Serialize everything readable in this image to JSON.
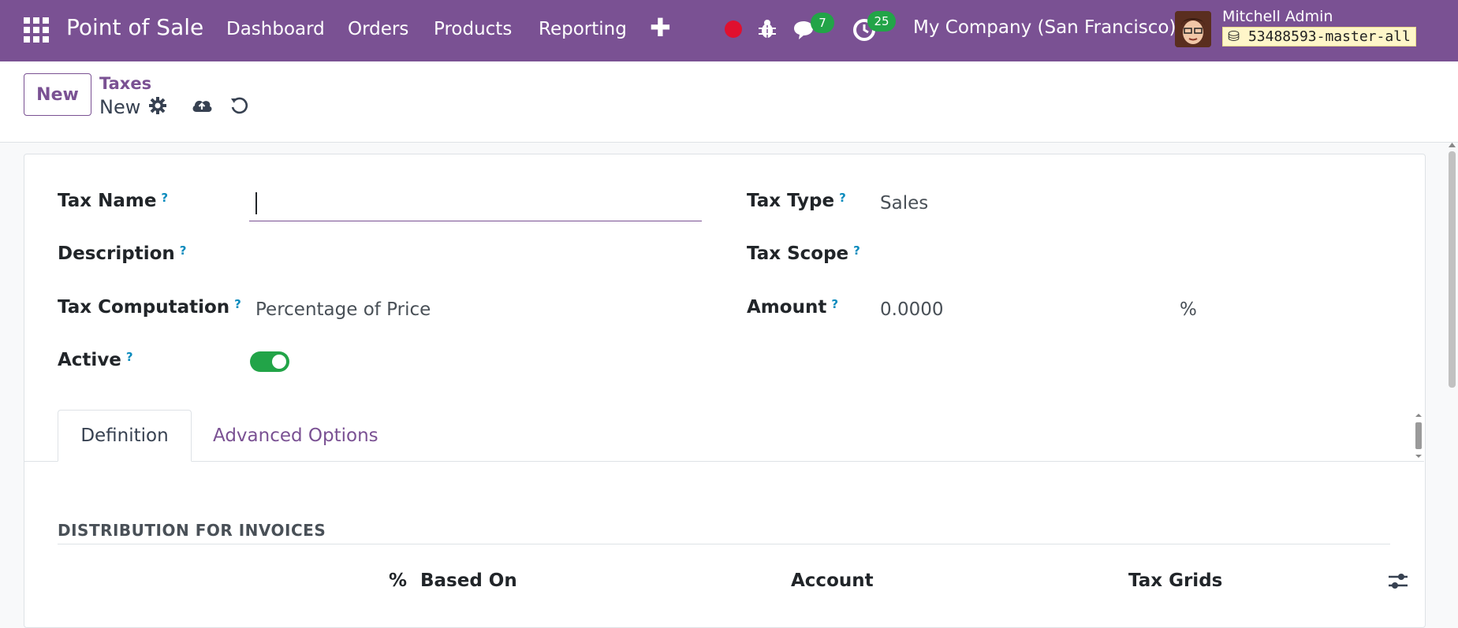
{
  "navbar": {
    "brand": "Point of Sale",
    "menu": [
      "Dashboard",
      "Orders",
      "Products",
      "Reporting"
    ],
    "plus": "✚",
    "chat_count": "7",
    "activity_count": "25",
    "company": "My Company (San Francisco)",
    "user": "Mitchell Admin",
    "database": "53488593-master-all",
    "accent_color": "#7a5193"
  },
  "control_panel": {
    "new_button": "New",
    "breadcrumb_parent": "Taxes",
    "breadcrumb_current": "New"
  },
  "form": {
    "tax_name_label": "Tax Name",
    "tax_name_value": "",
    "description_label": "Description",
    "tax_computation_label": "Tax Computation",
    "tax_computation_value": "Percentage of Price",
    "active_label": "Active",
    "active_value": true,
    "tax_type_label": "Tax Type",
    "tax_type_value": "Sales",
    "tax_scope_label": "Tax Scope",
    "amount_label": "Amount",
    "amount_value": "0.0000",
    "amount_unit": "%",
    "help_mark": "?"
  },
  "tabs": [
    "Definition",
    "Advanced Options"
  ],
  "distribution": {
    "title": "DISTRIBUTION FOR INVOICES",
    "columns": [
      "%",
      "Based On",
      "Account",
      "Tax Grids"
    ]
  }
}
